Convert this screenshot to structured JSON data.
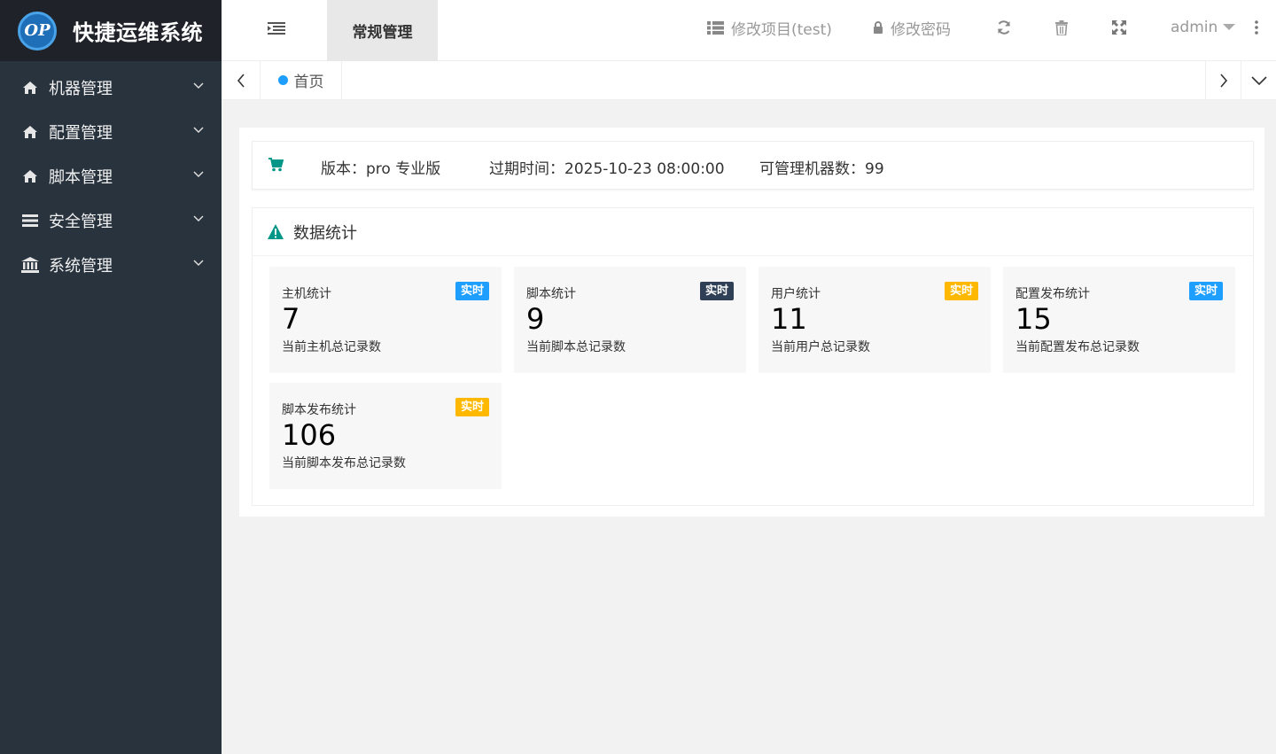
{
  "app": {
    "logo_text": "OP",
    "title": "快捷运维系统"
  },
  "sidebar": {
    "items": [
      {
        "label": "机器管理",
        "icon": "home-icon"
      },
      {
        "label": "配置管理",
        "icon": "home-icon"
      },
      {
        "label": "脚本管理",
        "icon": "home-icon"
      },
      {
        "label": "安全管理",
        "icon": "list-icon"
      },
      {
        "label": "系统管理",
        "icon": "bank-icon"
      }
    ]
  },
  "header": {
    "active_tab": "常规管理",
    "edit_project": "修改项目(test)",
    "change_password": "修改密码",
    "user": "admin"
  },
  "tabs": {
    "home": "首页"
  },
  "info": {
    "version": "版本：pro 专业版",
    "expire": "过期时间：2025-10-23 08:00:00",
    "machines": "可管理机器数：99"
  },
  "stats": {
    "title": "数据统计",
    "items": [
      {
        "name": "主机统计",
        "badge": "实时",
        "value": "7",
        "desc": "当前主机总记录数",
        "badge_color": "#1e9fff"
      },
      {
        "name": "脚本统计",
        "badge": "实时",
        "value": "9",
        "desc": "当前脚本总记录数",
        "badge_color": "#2f4056"
      },
      {
        "name": "用户统计",
        "badge": "实时",
        "value": "11",
        "desc": "当前用户总记录数",
        "badge_color": "#ffb800"
      },
      {
        "name": "配置发布统计",
        "badge": "实时",
        "value": "15",
        "desc": "当前配置发布总记录数",
        "badge_color": "#1e9fff"
      },
      {
        "name": "脚本发布统计",
        "badge": "实时",
        "value": "106",
        "desc": "当前脚本发布总记录数",
        "badge_color": "#ffb800"
      }
    ]
  },
  "colors": {
    "sidebar_bg": "#28333e",
    "logo_bg": "#20222a",
    "accent_teal": "#009688",
    "accent_blue": "#1e9fff"
  }
}
